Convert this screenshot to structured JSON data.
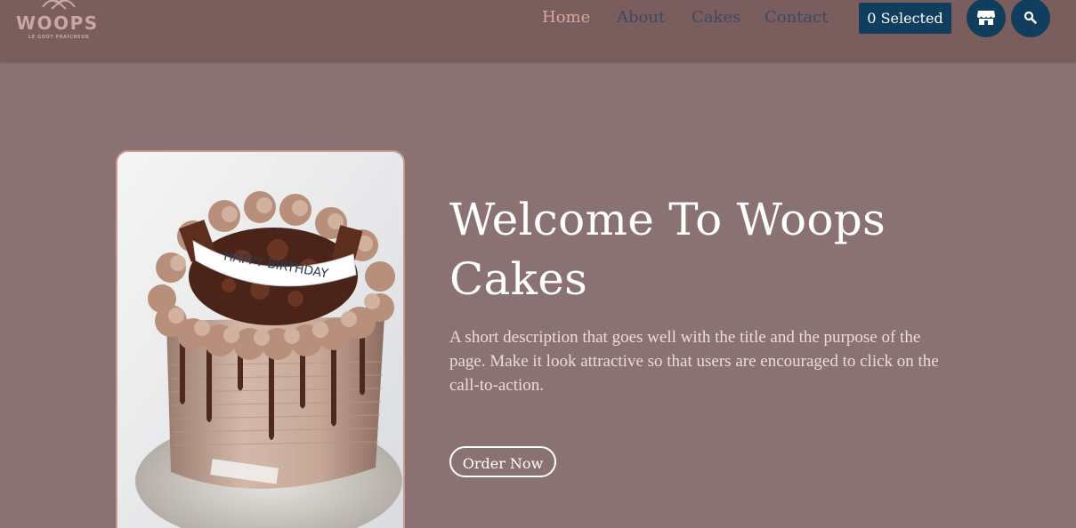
{
  "brand": {
    "name": "WOOPS",
    "tagline": "LE GOÛT FRAÎCHEUR",
    "logo_text_color": "#c9a6a0"
  },
  "nav": {
    "items": [
      {
        "label": "Home",
        "active": true
      },
      {
        "label": "About",
        "active": false
      },
      {
        "label": "Cakes",
        "active": false
      },
      {
        "label": "Contact",
        "active": false
      }
    ]
  },
  "header": {
    "selected_label": "0 Selected",
    "store_icon": "store-icon",
    "search_icon": "search-icon"
  },
  "hero": {
    "title": "Welcome To Woops Cakes",
    "description": "A short description that goes well with the title and the purpose of the page. Make it look attractive so that users are encouraged to click on the call-to-action.",
    "cta_label": "Order Now",
    "image_banner_text": "HAPPY BIRTHDAY"
  },
  "colors": {
    "header_bg": "#7a5d5d",
    "page_bg": "#8a7273",
    "accent_navy": "#123e5e",
    "nav_active": "#d5a9a0",
    "nav_inactive": "#3d4a66",
    "frame_border": "#c99a92"
  }
}
